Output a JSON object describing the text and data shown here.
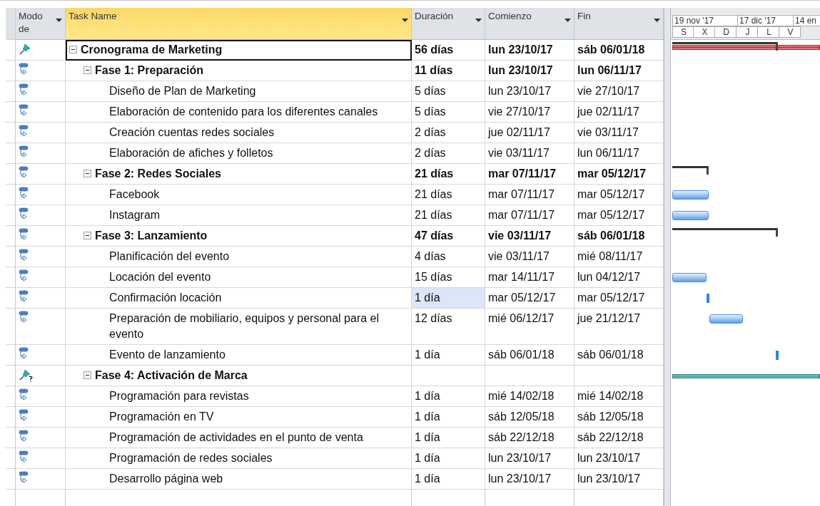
{
  "columns": [
    {
      "label": "Modo de",
      "kind": "mode"
    },
    {
      "label": "Task Name",
      "kind": "name",
      "selected": true
    },
    {
      "label": "Duración",
      "kind": "duration",
      "selected": false
    },
    {
      "label": "Comienzo",
      "kind": "start",
      "selected": false
    },
    {
      "label": "Fin",
      "kind": "finish",
      "selected": false
    }
  ],
  "timescale": {
    "top": [
      "19 nov '17",
      "17 dic '17",
      "14 en"
    ],
    "bottom": [
      "S",
      "X",
      "D",
      "J",
      "L",
      "V"
    ]
  },
  "tasks": [
    {
      "kind": "manual",
      "name": "Cronograma de Marketing",
      "duration": "56 días",
      "start": "lun 23/10/17",
      "finish": "sáb 06/01/18",
      "summary": true,
      "expanded": true,
      "selected": true,
      "highlighted": false,
      "bar": {
        "kind": "project"
      },
      "children": [
        {
          "kind": "auto",
          "name": "Fase 1: Preparación",
          "duration": "11 días",
          "start": "lun 23/10/17",
          "finish": "lun 06/11/17",
          "summary": true,
          "expanded": true,
          "selected": false,
          "highlighted": false,
          "children": [
            {
              "kind": "auto",
              "name": "Diseño de Plan de Marketing",
              "duration": "5 días",
              "start": "lun 23/10/17",
              "finish": "vie 27/10/17",
              "summary": false,
              "selected": false,
              "highlighted": false
            },
            {
              "kind": "auto",
              "name": "Elaboración de contenido para los diferentes canales",
              "duration": "5 días",
              "start": "vie 27/10/17",
              "finish": "jue 02/11/17",
              "summary": false,
              "selected": false,
              "highlighted": false
            },
            {
              "kind": "auto",
              "name": "Creación cuentas redes sociales",
              "duration": "2 días",
              "start": "jue 02/11/17",
              "finish": "vie 03/11/17",
              "summary": false,
              "selected": false,
              "highlighted": false
            },
            {
              "kind": "auto",
              "name": "Elaboración de afiches y folletos",
              "duration": "2 días",
              "start": "vie 03/11/17",
              "finish": "lun 06/11/17",
              "summary": false,
              "selected": false,
              "highlighted": false
            }
          ]
        },
        {
          "kind": "auto",
          "name": "Fase 2: Redes Sociales",
          "duration": "21 días",
          "start": "mar 07/11/17",
          "finish": "mar 05/12/17",
          "summary": true,
          "expanded": true,
          "selected": false,
          "highlighted": false,
          "bar": {
            "kind": "summary"
          },
          "children": [
            {
              "kind": "auto",
              "name": "Facebook",
              "duration": "21 días",
              "start": "mar 07/11/17",
              "finish": "mar 05/12/17",
              "summary": false,
              "selected": false,
              "highlighted": false,
              "bar": {
                "kind": "task"
              }
            },
            {
              "kind": "auto",
              "name": "Instagram",
              "duration": "21 días",
              "start": "mar 07/11/17",
              "finish": "mar 05/12/17",
              "summary": false,
              "selected": false,
              "highlighted": false,
              "bar": {
                "kind": "task"
              }
            }
          ]
        },
        {
          "kind": "auto",
          "name": "Fase 3: Lanzamiento",
          "duration": "47 días",
          "start": "vie 03/11/17",
          "finish": "sáb 06/01/18",
          "summary": true,
          "expanded": true,
          "selected": false,
          "highlighted": false,
          "bar": {
            "kind": "summary"
          },
          "children": [
            {
              "kind": "auto",
              "name": "Planificación del evento",
              "duration": "4 días",
              "start": "vie 03/11/17",
              "finish": "mié 08/11/17",
              "summary": false,
              "selected": false,
              "highlighted": false
            },
            {
              "kind": "auto",
              "name": "Locación del evento",
              "duration": "15 días",
              "start": "mar 14/11/17",
              "finish": "lun 04/12/17",
              "summary": false,
              "selected": false,
              "highlighted": false,
              "bar": {
                "kind": "task"
              }
            },
            {
              "kind": "auto",
              "name": "Confirmación locación",
              "duration": "1 día",
              "start": "mar 05/12/17",
              "finish": "mar 05/12/17",
              "summary": false,
              "selected": false,
              "highlighted": true,
              "bar": {
                "kind": "marker"
              }
            },
            {
              "kind": "auto",
              "name": "Preparación de mobiliario, equipos y personal para el evento",
              "duration": "12 días",
              "start": "mié 06/12/17",
              "finish": "jue 21/12/17",
              "summary": false,
              "selected": false,
              "highlighted": false,
              "bar": {
                "kind": "task"
              }
            },
            {
              "kind": "auto",
              "name": "Evento de lanzamiento",
              "duration": "1 día",
              "start": "sáb 06/01/18",
              "finish": "sáb 06/01/18",
              "summary": false,
              "selected": false,
              "highlighted": false,
              "bar": {
                "kind": "marker"
              }
            }
          ]
        },
        {
          "kind": "manual_question",
          "name": "Fase 4: Activación de Marca",
          "summary": true,
          "expanded": true,
          "selected": false,
          "highlighted": false,
          "bar": {
            "kind": "manual_summary"
          },
          "children": [
            {
              "kind": "auto",
              "name": "Programación para revistas",
              "duration": "1 día",
              "start": "mié 14/02/18",
              "finish": "mié 14/02/18",
              "summary": false,
              "selected": false,
              "highlighted": false
            },
            {
              "kind": "auto",
              "name": "Programación en TV",
              "duration": "1 día",
              "start": "sáb 12/05/18",
              "finish": "sáb 12/05/18",
              "summary": false,
              "selected": false,
              "highlighted": false
            },
            {
              "kind": "auto",
              "name": "Programación de actividades en el punto de venta",
              "duration": "1 día",
              "start": "sáb 22/12/18",
              "finish": "sáb 22/12/18",
              "summary": false,
              "selected": false,
              "highlighted": false
            },
            {
              "kind": "auto",
              "name": "Programación de redes sociales",
              "duration": "1 día",
              "start": "lun 23/10/17",
              "finish": "lun 23/10/17",
              "summary": false,
              "selected": false,
              "highlighted": false
            },
            {
              "kind": "auto",
              "name": "Desarrollo página web",
              "duration": "1 día",
              "start": "lun 23/10/17",
              "finish": "lun 23/10/17",
              "summary": false,
              "selected": false,
              "highlighted": false
            }
          ]
        }
      ]
    }
  ]
}
